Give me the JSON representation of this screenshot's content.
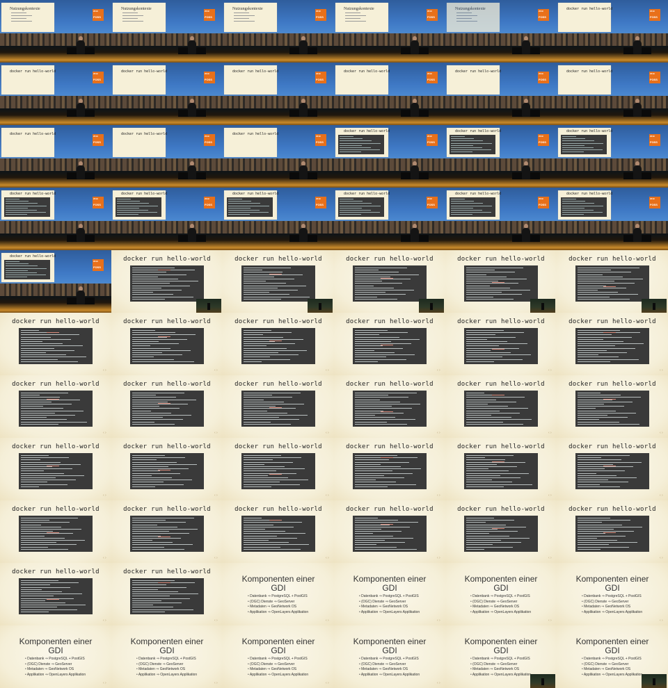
{
  "frames": [
    {
      "kind": "stage",
      "slide": "title",
      "slide_title": "Nutzungskontexte"
    },
    {
      "kind": "stage",
      "slide": "title",
      "slide_title": "Nutzungskontexte"
    },
    {
      "kind": "stage",
      "slide": "title",
      "slide_title": "Nutzungskontexte"
    },
    {
      "kind": "stage",
      "slide": "title",
      "slide_title": "Nutzungskontexte"
    },
    {
      "kind": "stage",
      "slide": "fade",
      "slide_title": "Nutzungskontexte"
    },
    {
      "kind": "stage",
      "slide": "code",
      "slide_title": "docker run hello-world"
    },
    {
      "kind": "stage",
      "slide": "code",
      "slide_title": "docker run hello-world"
    },
    {
      "kind": "stage",
      "slide": "code",
      "slide_title": "docker run hello-world"
    },
    {
      "kind": "stage",
      "slide": "code",
      "slide_title": "docker run hello-world"
    },
    {
      "kind": "stage",
      "slide": "code",
      "slide_title": "docker run hello-world"
    },
    {
      "kind": "stage",
      "slide": "code",
      "slide_title": "docker run hello-world"
    },
    {
      "kind": "stage",
      "slide": "code",
      "slide_title": "docker run hello-world"
    },
    {
      "kind": "stage",
      "slide": "code",
      "slide_title": "docker run hello-world"
    },
    {
      "kind": "stage",
      "slide": "code",
      "slide_title": "docker run hello-world"
    },
    {
      "kind": "stage",
      "slide": "code",
      "slide_title": "docker run hello-world"
    },
    {
      "kind": "stage",
      "slide": "term",
      "slide_title": "docker run hello-world"
    },
    {
      "kind": "stage",
      "slide": "term",
      "slide_title": "docker run hello-world"
    },
    {
      "kind": "stage",
      "slide": "term",
      "slide_title": "docker run hello-world"
    },
    {
      "kind": "stage",
      "slide": "term",
      "slide_title": "docker run hello-world"
    },
    {
      "kind": "stage",
      "slide": "term",
      "slide_title": "docker run hello-world"
    },
    {
      "kind": "stage",
      "slide": "term",
      "slide_title": "docker run hello-world"
    },
    {
      "kind": "stage",
      "slide": "term",
      "slide_title": "docker run hello-world"
    },
    {
      "kind": "stage",
      "slide": "term",
      "slide_title": "docker run hello-world"
    },
    {
      "kind": "stage",
      "slide": "term",
      "slide_title": "docker run hello-world"
    },
    {
      "kind": "stage",
      "slide": "term",
      "slide_title": "docker run hello-world"
    },
    {
      "kind": "docker",
      "title": "docker run hello-world",
      "pip": true
    },
    {
      "kind": "docker",
      "title": "docker run hello-world",
      "pip": true
    },
    {
      "kind": "docker",
      "title": "docker run hello-world",
      "pip": true
    },
    {
      "kind": "docker",
      "title": "docker run hello-world",
      "pip": true
    },
    {
      "kind": "docker",
      "title": "docker run hello-world",
      "pip": true
    },
    {
      "kind": "docker",
      "title": "docker run hello-world",
      "pip": false
    },
    {
      "kind": "docker",
      "title": "docker run hello-world",
      "pip": false
    },
    {
      "kind": "docker",
      "title": "docker run hello-world",
      "pip": false
    },
    {
      "kind": "docker",
      "title": "docker run hello-world",
      "pip": false
    },
    {
      "kind": "docker",
      "title": "docker run hello-world",
      "pip": false
    },
    {
      "kind": "docker",
      "title": "docker run hello-world",
      "pip": false
    },
    {
      "kind": "docker",
      "title": "docker run hello-world",
      "pip": false
    },
    {
      "kind": "docker",
      "title": "docker run hello-world",
      "pip": false
    },
    {
      "kind": "docker",
      "title": "docker run hello-world",
      "pip": false
    },
    {
      "kind": "docker",
      "title": "docker run hello-world",
      "pip": false
    },
    {
      "kind": "docker",
      "title": "docker run hello-world",
      "pip": false
    },
    {
      "kind": "docker",
      "title": "docker run hello-world",
      "pip": false
    },
    {
      "kind": "docker",
      "title": "docker run hello-world",
      "pip": false
    },
    {
      "kind": "docker",
      "title": "docker run hello-world",
      "pip": false
    },
    {
      "kind": "docker",
      "title": "docker run hello-world",
      "pip": false
    },
    {
      "kind": "docker",
      "title": "docker run hello-world",
      "pip": false
    },
    {
      "kind": "docker",
      "title": "docker run hello-world",
      "pip": false
    },
    {
      "kind": "docker",
      "title": "docker run hello-world",
      "pip": false
    },
    {
      "kind": "docker",
      "title": "docker run hello-world",
      "pip": false
    },
    {
      "kind": "docker",
      "title": "docker run hello-world",
      "pip": false
    },
    {
      "kind": "docker",
      "title": "docker run hello-world",
      "pip": false
    },
    {
      "kind": "docker",
      "title": "docker run hello-world",
      "pip": false
    },
    {
      "kind": "docker",
      "title": "docker run hello-world",
      "pip": false
    },
    {
      "kind": "docker",
      "title": "docker run hello-world",
      "pip": false
    },
    {
      "kind": "docker",
      "title": "docker run hello-world",
      "pip": false
    },
    {
      "kind": "docker",
      "title": "docker run hello-world",
      "pip": false
    },
    {
      "kind": "gdi",
      "title": "Komponenten einer GDI",
      "pip": false
    },
    {
      "kind": "gdi",
      "title": "Komponenten einer GDI",
      "pip": false
    },
    {
      "kind": "gdi",
      "title": "Komponenten einer GDI",
      "pip": false
    },
    {
      "kind": "gdi",
      "title": "Komponenten einer GDI",
      "pip": false
    },
    {
      "kind": "gdi",
      "title": "Komponenten einer GDI",
      "pip": false
    },
    {
      "kind": "gdi",
      "title": "Komponenten einer GDI",
      "pip": false
    },
    {
      "kind": "gdi",
      "title": "Komponenten einer GDI",
      "pip": false
    },
    {
      "kind": "gdi",
      "title": "Komponenten einer GDI",
      "pip": false
    },
    {
      "kind": "gdi",
      "title": "Komponenten einer GDI",
      "pip": true
    },
    {
      "kind": "gdi",
      "title": "Komponenten einer GDI",
      "pip": true
    }
  ],
  "gdi_bullets": [
    "Datenbank ⇒ PostgreSQL + PostGIS",
    "(OGC) Dienste ⇒ GeoServer",
    "Metadaten ⇒ GeoNetwork OS",
    "Applikation ⇒ OpenLayers Applikation"
  ],
  "logo": {
    "year": "2019",
    "word": "FOSS"
  },
  "nav_symbol": "‹ ›",
  "colors": {
    "accent": "#e8701a",
    "terminal": "#3a3a3a",
    "paper": "#f6f0d8"
  }
}
